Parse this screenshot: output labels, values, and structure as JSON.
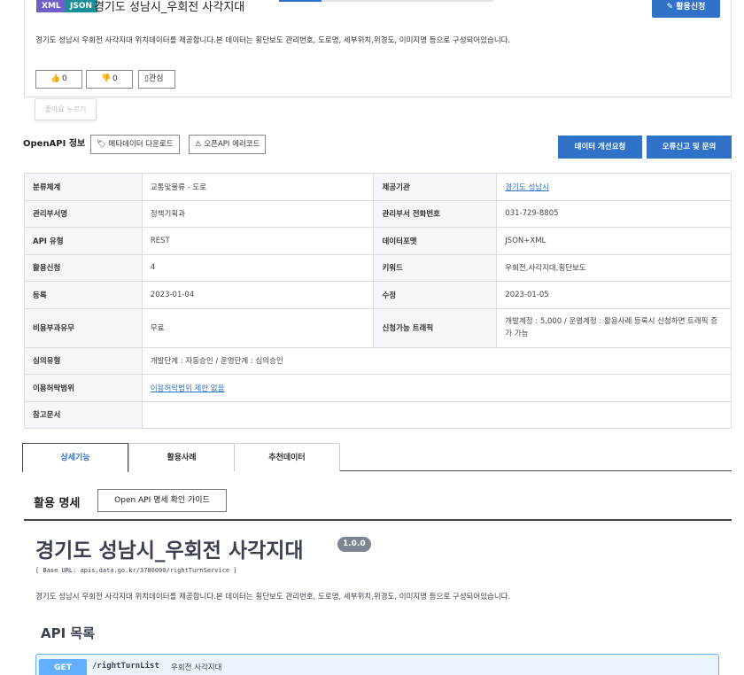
{
  "header": {
    "badges": [
      "XML",
      "JSON"
    ],
    "title": "경기도 성남시_우회전 사각지대",
    "apply_button": "활용신청",
    "description": "경기도 성남시 우회전 사각지대 위치데이터를 제공합니다.본 데이터는 횡단보도 관리번호, 도로명, 세부위치,위경도, 이미지명 등으로 구성되어있습니다.",
    "like_count": "0",
    "dislike_count": "0",
    "bookmark_label": "관심",
    "tooltip": "좋아요 누르기"
  },
  "openapi": {
    "label": "OpenAPI 정보",
    "meta_download": "메타데이터 다운로드",
    "error_code": "오픈API 에러코드",
    "improve_request": "데이터 개선요청",
    "report": "오류신고 및 문의"
  },
  "info_table": {
    "category_h": "분류체계",
    "category_v": "교통및물류 - 도로",
    "provider_h": "제공기관",
    "provider_v": "경기도 성남시",
    "dept_h": "관리부서명",
    "dept_v": "정책기획과",
    "phone_h": "관리부서 전화번호",
    "phone_v": "031-729-8805",
    "apitype_h": "API 유형",
    "apitype_v": "REST",
    "format_h": "데이터포맷",
    "format_v": "JSON+XML",
    "apply_h": "활용신청",
    "apply_v": "4",
    "keyword_h": "키워드",
    "keyword_v": "우회전,사각지대,횡단보도",
    "reg_h": "등록",
    "reg_v": "2023-01-04",
    "mod_h": "수정",
    "mod_v": "2023-01-05",
    "cost_h": "비용부과유무",
    "cost_v": "무료",
    "traffic_h": "신청가능 트래픽",
    "traffic_v": "개발계정 : 5,000 / 운영계정 : 활용사례 등록시 신청하면 트래픽 증가 가능",
    "review_h": "심의유형",
    "review_v": "개발단계 : 자동승인 / 운영단계 : 심의승인",
    "license_h": "이용허락범위",
    "license_v": "이용허락범위 제한 없음",
    "ref_h": "참고문서",
    "ref_v": ""
  },
  "tabs": [
    "상세기능",
    "활용사례",
    "추천데이터"
  ],
  "spec": {
    "label": "활용 명세",
    "guide_button": "Open API 명세 확인 가이드"
  },
  "swagger": {
    "title": "경기도 성남시_우회전 사각지대",
    "version": "1.0.0",
    "base_url": "[ Base URL: apis.data.go.kr/3780000/rightTurnService ]",
    "description": "경기도 성남시 우회전 사각지대 위치데이터를 제공합니다.본 데이터는 횡단보도 관리번호, 도로명, 세부위치,위경도, 이미지명 등으로 구성되어있습니다.",
    "api_list_title": "API 목록",
    "operation": {
      "method": "GET",
      "path": "/rightTurnList",
      "summary": "우회전 사각지대"
    }
  },
  "colors": {
    "primary": "#2f72c7",
    "xml_badge": "#6e60c7",
    "json_badge": "#1a8f9a",
    "get_method": "#61affe"
  }
}
